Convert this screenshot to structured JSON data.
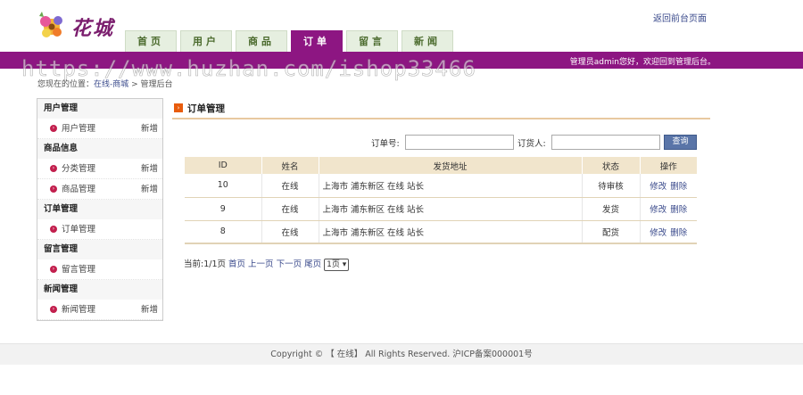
{
  "header": {
    "logo_text": "花城",
    "back_link": "返回前台页面"
  },
  "nav": {
    "tabs": [
      {
        "label": "首页"
      },
      {
        "label": "用户"
      },
      {
        "label": "商品"
      },
      {
        "label": "订单",
        "active": true
      },
      {
        "label": "留言"
      },
      {
        "label": "新闻"
      }
    ]
  },
  "topbar": {
    "greeting": "管理员admin您好，欢迎回到管理后台。"
  },
  "watermark": "https://www.huzhan.com/ishop33466",
  "breadcrumb": {
    "prefix": "您现在的位置：",
    "link": "在线-商城",
    "sep": " > ",
    "current": "管理后台"
  },
  "sidebar": {
    "sections": [
      {
        "title": "用户管理",
        "items": [
          {
            "label": "用户管理",
            "add": "新增"
          }
        ]
      },
      {
        "title": "商品信息",
        "items": [
          {
            "label": "分类管理",
            "add": "新增"
          },
          {
            "label": "商品管理",
            "add": "新增"
          }
        ]
      },
      {
        "title": "订单管理",
        "items": [
          {
            "label": "订单管理",
            "add": ""
          }
        ]
      },
      {
        "title": "留言管理",
        "items": [
          {
            "label": "留言管理",
            "add": ""
          }
        ]
      },
      {
        "title": "新闻管理",
        "items": [
          {
            "label": "新闻管理",
            "add": "新增"
          }
        ]
      }
    ]
  },
  "main": {
    "title": "订单管理",
    "search": {
      "order_no_label": "订单号:",
      "order_no_value": "",
      "buyer_label": "订货人:",
      "buyer_value": "",
      "button": "查询"
    },
    "table": {
      "headers": [
        "ID",
        "姓名",
        "发货地址",
        "状态",
        "操作"
      ],
      "rows": [
        {
          "id": "10",
          "name": "在线",
          "address": "上海市 浦东新区 在线 站长",
          "status": "待审核",
          "edit": "修改",
          "delete": "删除"
        },
        {
          "id": "9",
          "name": "在线",
          "address": "上海市 浦东新区 在线 站长",
          "status": "发货",
          "edit": "修改",
          "delete": "删除"
        },
        {
          "id": "8",
          "name": "在线",
          "address": "上海市 浦东新区 在线 站长",
          "status": "配货",
          "edit": "修改",
          "delete": "删除"
        }
      ]
    },
    "pager": {
      "current": "当前:1/1页",
      "first": "首页",
      "prev": "上一页",
      "next": "下一页",
      "last": "尾页",
      "select_value": "1页"
    }
  },
  "footer": {
    "text": "Copyright © 【 在线】 All Rights Reserved. 沪ICP备案000001号"
  },
  "colors": {
    "brand_purple": "#8d1682",
    "nav_tab_bg": "#e6efe0",
    "table_header_bg": "#f1e5cc",
    "link_blue": "#3b4b8c",
    "bullet_red": "#c21f4d",
    "search_button": "#5a75a8"
  },
  "icons": {
    "logo": "flower-logo-icon",
    "sidebar_bullet": "arrow-circle-icon",
    "panel_title": "arrow-square-icon",
    "select_caret": "chevron-down-icon"
  }
}
